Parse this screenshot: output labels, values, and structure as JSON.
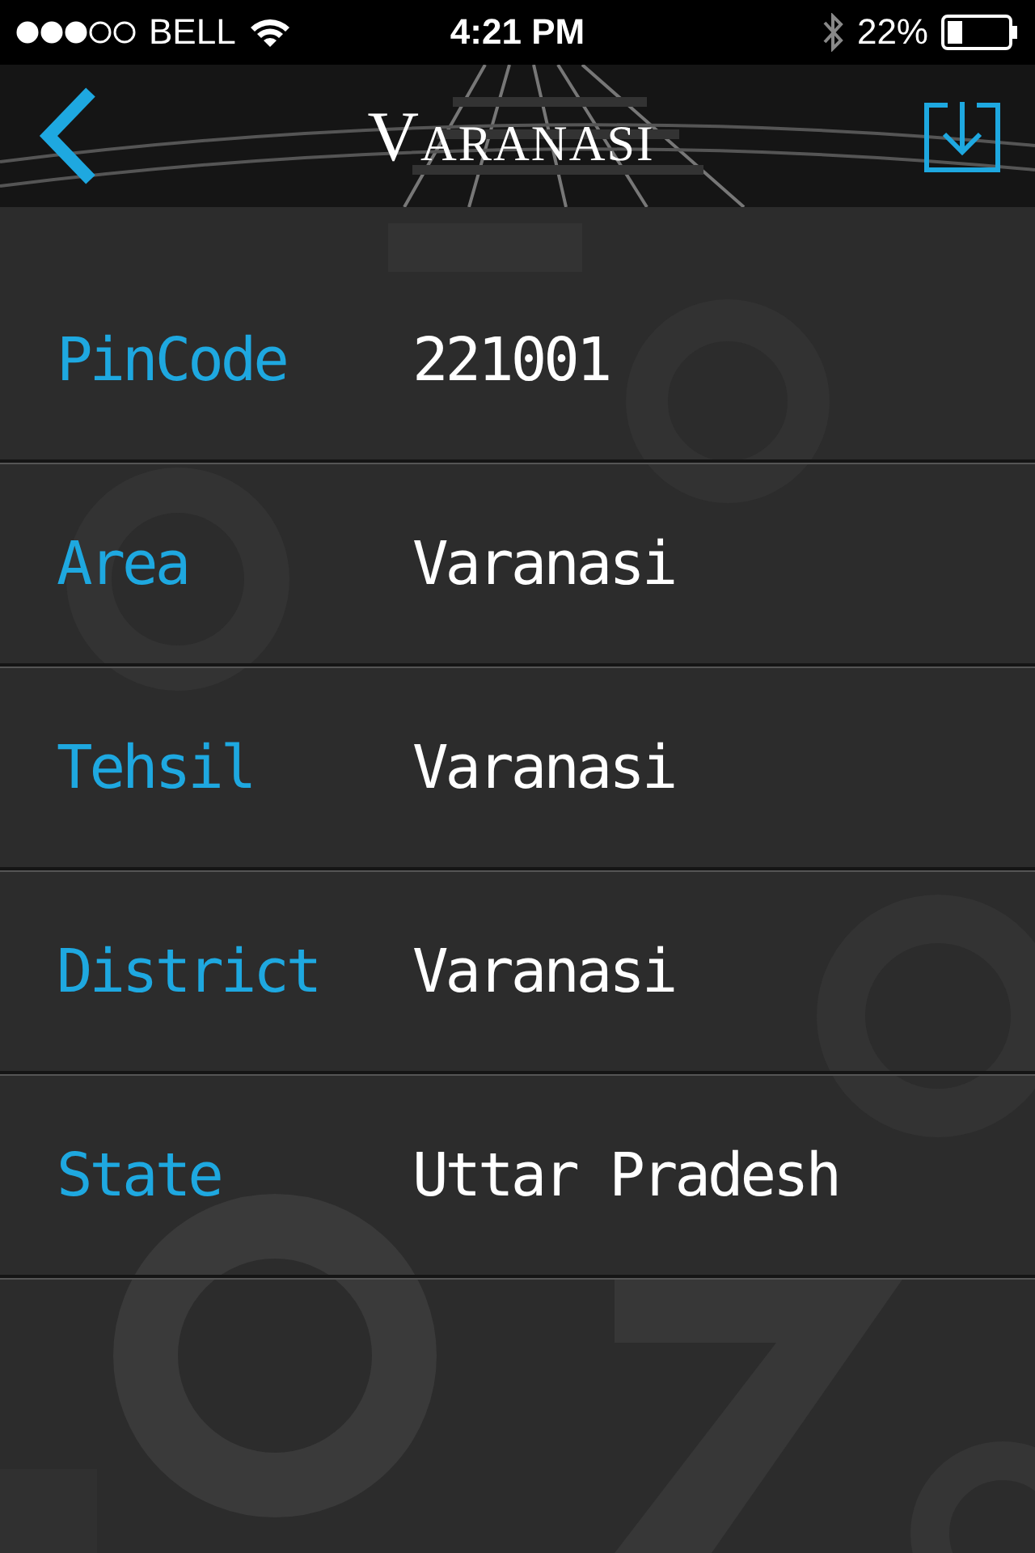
{
  "status_bar": {
    "carrier": "BELL",
    "time": "4:21 PM",
    "battery": "22%"
  },
  "nav_bar": {
    "title": "Varanasi"
  },
  "details": [
    {
      "label": "PinCode",
      "value": "221001"
    },
    {
      "label": "Area",
      "value": "Varanasi"
    },
    {
      "label": "Tehsil",
      "value": "Varanasi"
    },
    {
      "label": "District",
      "value": "Varanasi"
    },
    {
      "label": "State",
      "value": "Uttar Pradesh"
    }
  ]
}
